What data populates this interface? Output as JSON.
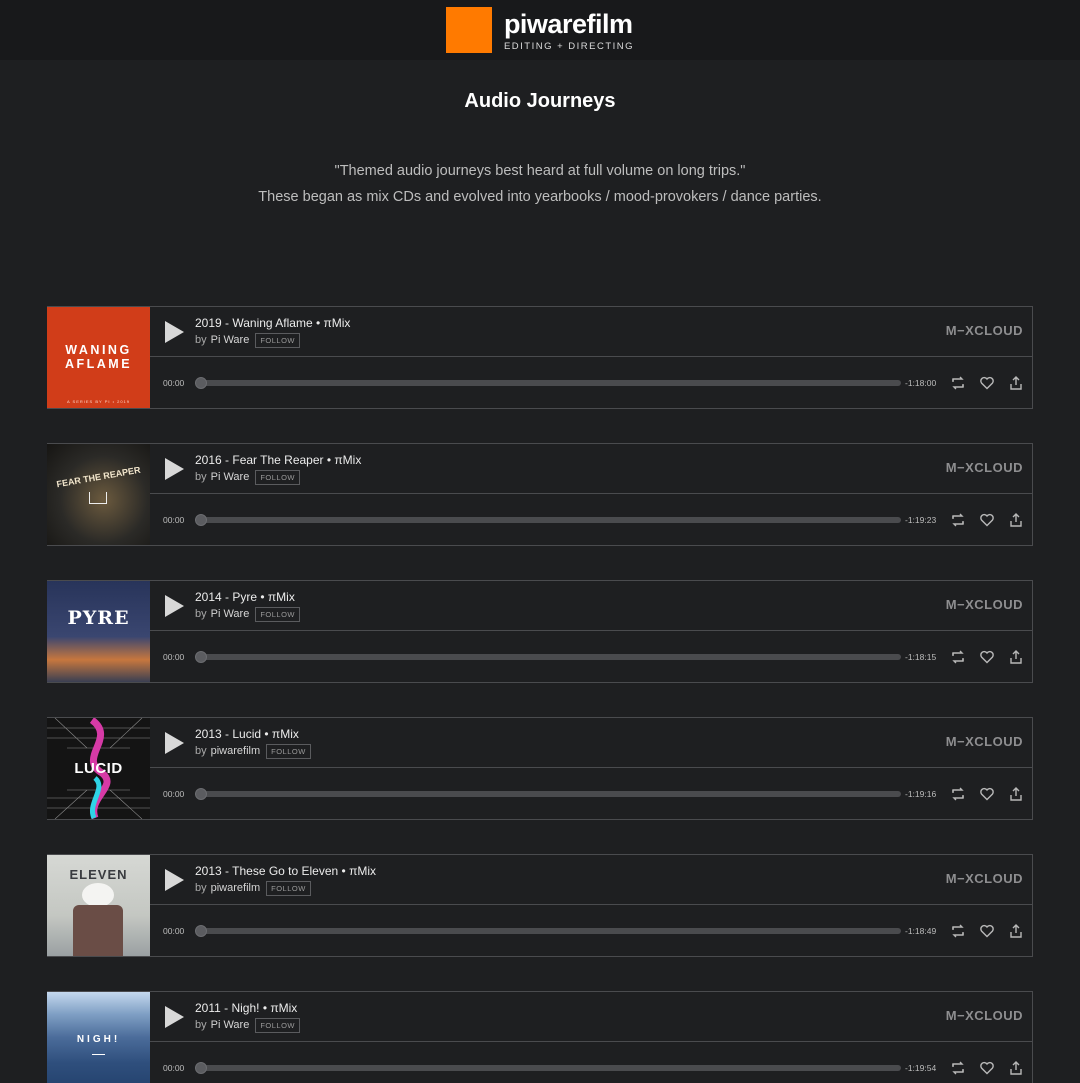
{
  "header": {
    "logo_title": "piwarefilm",
    "logo_subtitle": "EDITING + DIRECTING",
    "logo_color": "#ff7a00"
  },
  "page": {
    "title": "Audio Journeys",
    "intro_line1": "\"Themed audio journeys best heard at full volume on long trips.\"",
    "intro_line2": "These began as mix CDs and evolved into yearbooks / mood-provokers / dance parties."
  },
  "player_common": {
    "by_label": "by",
    "follow_label": "FOLLOW",
    "brand": "M−XCLOUD",
    "start_time": "00:00"
  },
  "players": [
    {
      "title": "2019 - Waning Aflame • πMix",
      "artist": "Pi Ware",
      "remaining": "-1:18:00",
      "art_text": "WANING AFLAME",
      "art_small": "A SERIES BY PI • 2019",
      "art_bg": "#d13d19"
    },
    {
      "title": "2016 - Fear The Reaper • πMix",
      "artist": "Pi Ware",
      "remaining": "-1:19:23",
      "art_text": "FEAR THE REAPER",
      "art_bg": "#2b2a27"
    },
    {
      "title": "2014 - Pyre • πMix",
      "artist": "Pi Ware",
      "remaining": "-1:18:15",
      "art_text": "PYRE",
      "art_bg": "#2d3a57"
    },
    {
      "title": "2013 - Lucid • πMix",
      "artist": "piwarefilm",
      "remaining": "-1:19:16",
      "art_text": "LUCID",
      "art_bg": "#141414"
    },
    {
      "title": "2013 - These Go to Eleven • πMix",
      "artist": "piwarefilm",
      "remaining": "-1:18:49",
      "art_text": "ELEVEN",
      "art_bg": "#c9ccc8"
    },
    {
      "title": "2011 - Nigh! • πMix",
      "artist": "Pi Ware",
      "remaining": "-1:19:54",
      "art_text": "NIGH!",
      "art_bg": "#3f5f8c"
    }
  ]
}
